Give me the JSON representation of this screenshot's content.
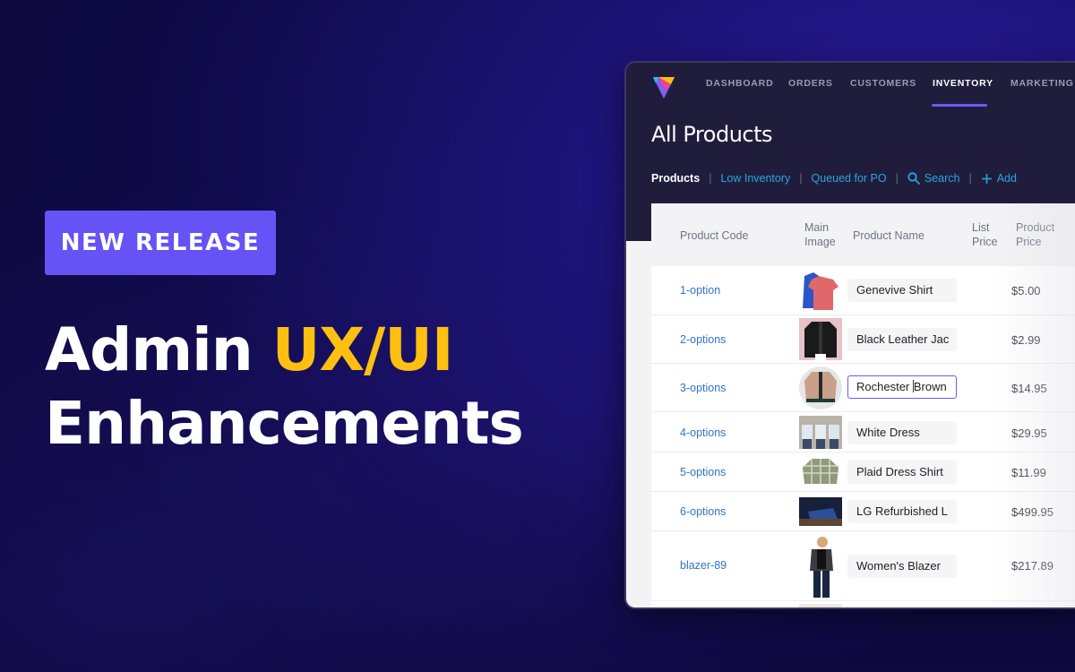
{
  "promo": {
    "badge": "NEW RELEASE",
    "headline_line1_plain": "Admin ",
    "headline_line1_accent": "UX/UI",
    "headline_line2": "Enhancements",
    "colors": {
      "badge_bg": "#6553f5",
      "accent": "#fdc010",
      "background": "#0f0a45"
    }
  },
  "app": {
    "logo_icon": "triangle-logo-icon",
    "nav": [
      {
        "label": "DASHBOARD",
        "active": false
      },
      {
        "label": "ORDERS",
        "active": false
      },
      {
        "label": "CUSTOMERS",
        "active": false
      },
      {
        "label": "INVENTORY",
        "active": true
      },
      {
        "label": "MARKETING",
        "active": false
      }
    ],
    "page_title": "All Products",
    "subnav": {
      "products": "Products",
      "low_inventory": "Low Inventory",
      "queued_for_po": "Queued for PO",
      "search": "Search",
      "search_icon": "search-icon",
      "add": "Add",
      "add_icon": "plus-icon",
      "separator": "|"
    },
    "table": {
      "headers": {
        "product_code": "Product Code",
        "main_image_1": "Main",
        "main_image_2": "Image",
        "product_name": "Product Name",
        "list_price_1": "List",
        "list_price_2": "Price",
        "product_price_1": "Product",
        "product_price_2": "Price"
      },
      "rows": [
        {
          "code": "1-option",
          "image": "shirts-thumbnail",
          "name": "Genevive Shirt",
          "list_price": "",
          "price": "$5.00"
        },
        {
          "code": "2-options",
          "image": "black-jacket-thumbnail",
          "name": "Black Leather Jac",
          "list_price": "",
          "price": "$2.99"
        },
        {
          "code": "3-options",
          "image": "brown-jacket-thumbnail",
          "name_before_caret": "Rochester ",
          "name_after_caret": "Brown",
          "list_price": "",
          "price": "$14.95",
          "editing": true
        },
        {
          "code": "4-options",
          "image": "white-dress-thumbnail",
          "name": "White Dress",
          "list_price": "",
          "price": "$29.95"
        },
        {
          "code": "5-options",
          "image": "plaid-shirt-thumbnail",
          "name": "Plaid Dress Shirt",
          "list_price": "",
          "price": "$11.99"
        },
        {
          "code": "6-options",
          "image": "laptop-thumbnail",
          "name": "LG Refurbished L",
          "list_price": "",
          "price": "$499.95"
        },
        {
          "code": "blazer-89",
          "image": "blazer-thumbnail",
          "name": "Women's Blazer",
          "list_price": "",
          "price": "$217.89"
        }
      ]
    },
    "colors": {
      "nav_bg": "#201d3c",
      "active_underline": "#6a5af9",
      "link": "#2ba4e0",
      "code_link": "#2f74c8"
    }
  }
}
